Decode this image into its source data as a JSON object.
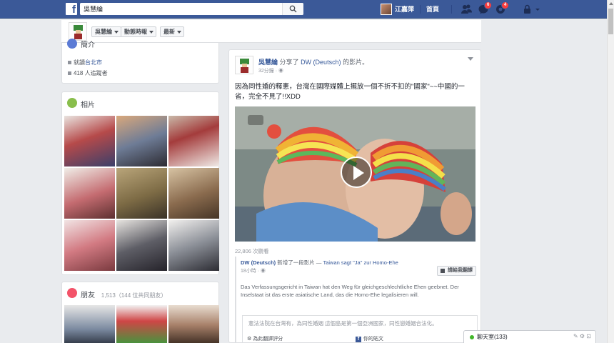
{
  "topbar": {
    "logo": "f",
    "search_value": "吳慧綸",
    "user_name": "江嘉萍",
    "home_label": "首頁",
    "notif_badge_1": "6",
    "notif_badge_2": "4"
  },
  "subheader": {
    "btn_profile": "吳慧綸",
    "btn_edit": "動態時報",
    "btn_recent": "最新"
  },
  "intro": {
    "title": "簡介",
    "row1_prefix": "就讀",
    "row1_link": "台北市",
    "row2": "418 人追蹤者"
  },
  "photos": {
    "title": "相片"
  },
  "friends": {
    "title": "朋友",
    "count": "1,513",
    "mutual": "（144 位共同朋友）"
  },
  "post": {
    "author": "吳慧綸",
    "action": "分享了",
    "source": "DW (Deutsch)",
    "source_suffix": "的影片。",
    "time": "32分鐘",
    "text": "因為同性婚的釋憲，台灣在國際媒體上擺放一個不折不扣的\"國家\"~~中國的一省，完全不見了!!XDD",
    "views": "22,806 次觀看",
    "shared_author": "DW (Deutsch)",
    "shared_action": "新增了一段影片 —",
    "shared_title": "Taiwan sagt \"Ja\" zur Homo-Ehe",
    "shared_time": "18小時",
    "translate_btn": "請給我翻譯",
    "shared_body": "Das Verfassungsgericht in Taiwan hat den Weg für gleichgeschlechtliche Ehen geebnet. Der Inselstaat ist das erste asiatische Land, das die Homo-Ehe legalisieren will.",
    "shared_translation": "憲法法院在台灣有，為同性婚姻 這個島是第一個亞洲國家，同性戀婚姻合法化。",
    "rate_label": "為此翻譯評分",
    "my_translation": "你的貼文"
  },
  "chat": {
    "label": "聊天室(133)",
    "icons": "✎ ⚙ ⊡"
  },
  "colors": {
    "brand": "#3b5998",
    "background": "#e9ebee",
    "link": "#365899"
  }
}
